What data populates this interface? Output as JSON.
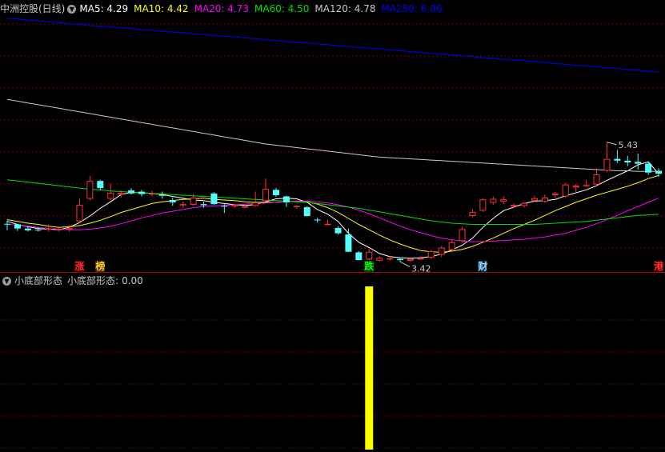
{
  "main_header": {
    "title": "中洲控股(日线)",
    "ma_items": [
      {
        "label": "MA5:",
        "value": "4.29",
        "color": "#ffffff"
      },
      {
        "label": "MA10:",
        "value": "4.42",
        "color": "#ffff00"
      },
      {
        "label": "MA20:",
        "value": "4.73",
        "color": "#ff00ff"
      },
      {
        "label": "MA60:",
        "value": "4.50",
        "color": "#00e000"
      },
      {
        "label": "MA120:",
        "value": "4.78",
        "color": "#c8c8c8"
      },
      {
        "label": "MA250:",
        "value": "6.06",
        "color": "#0000ff"
      }
    ]
  },
  "sub_header": {
    "title": "小底部形态",
    "indicator_label": "小底部形态:",
    "indicator_value": "0.00"
  },
  "event_tags": [
    {
      "text": "涨",
      "color": "#ff3030",
      "bg": "#3a0000",
      "index": 7
    },
    {
      "text": "榜",
      "color": "#ffcc33",
      "bg": "#3a2a00",
      "index": 9
    },
    {
      "text": "跌",
      "color": "#00ff00",
      "bg": "#003a00",
      "index": 35
    },
    {
      "text": "财",
      "color": "#9fd7ff",
      "bg": "#002a4a",
      "index": 46
    },
    {
      "text": "港",
      "color": "#ff3030",
      "bg": "#3a0000",
      "index": 63
    }
  ],
  "price_annotations": {
    "high_label": "5.43",
    "low_label": "3.42"
  },
  "colors": {
    "up": "#ff3232",
    "down": "#54ffff",
    "grid": "#800000",
    "signal": "#ffff00"
  },
  "chart_data": {
    "type": "candlestick",
    "y_axis": "price",
    "ohlc": [
      [
        4.06,
        4.12,
        3.95,
        4.05
      ],
      [
        4.05,
        4.06,
        3.94,
        3.98
      ],
      [
        3.98,
        4.02,
        3.93,
        3.95
      ],
      [
        3.96,
        4.0,
        3.93,
        3.95
      ],
      [
        3.97,
        4.05,
        3.93,
        3.98
      ],
      [
        3.97,
        3.99,
        3.93,
        3.97
      ],
      [
        3.96,
        4.04,
        3.93,
        3.99
      ],
      [
        4.1,
        4.48,
        4.08,
        4.38
      ],
      [
        4.48,
        4.86,
        4.45,
        4.78
      ],
      [
        4.78,
        4.8,
        4.62,
        4.66
      ],
      [
        4.48,
        4.74,
        4.45,
        4.58
      ],
      [
        4.55,
        4.62,
        4.5,
        4.58
      ],
      [
        4.62,
        4.66,
        4.55,
        4.57
      ],
      [
        4.6,
        4.63,
        4.52,
        4.56
      ],
      [
        4.55,
        4.62,
        4.52,
        4.57
      ],
      [
        4.55,
        4.6,
        4.48,
        4.53
      ],
      [
        4.46,
        4.5,
        4.36,
        4.42
      ],
      [
        4.38,
        4.43,
        4.33,
        4.39
      ],
      [
        4.38,
        4.56,
        4.36,
        4.5
      ],
      [
        4.39,
        4.43,
        4.33,
        4.37
      ],
      [
        4.57,
        4.59,
        4.38,
        4.39
      ],
      [
        4.36,
        4.39,
        4.24,
        4.35
      ],
      [
        4.35,
        4.37,
        4.33,
        4.38
      ],
      [
        4.33,
        4.38,
        4.32,
        4.36
      ],
      [
        4.36,
        4.6,
        4.35,
        4.42
      ],
      [
        4.45,
        4.82,
        4.43,
        4.65
      ],
      [
        4.63,
        4.66,
        4.51,
        4.54
      ],
      [
        4.52,
        4.53,
        4.34,
        4.42
      ],
      [
        4.34,
        4.37,
        4.31,
        4.36
      ],
      [
        4.34,
        4.35,
        4.18,
        4.19
      ],
      [
        4.13,
        4.16,
        4.08,
        4.12
      ],
      [
        4.05,
        4.13,
        4.04,
        4.06
      ],
      [
        3.99,
        4.02,
        3.88,
        3.9
      ],
      [
        3.88,
        3.98,
        3.76,
        3.59
      ],
      [
        3.58,
        3.6,
        3.58,
        3.45
      ],
      [
        3.46,
        3.64,
        3.45,
        3.59
      ],
      [
        3.44,
        3.51,
        3.43,
        3.49
      ],
      [
        3.48,
        3.51,
        3.44,
        3.48
      ],
      [
        3.47,
        3.48,
        3.42,
        3.45
      ],
      [
        3.44,
        3.47,
        3.42,
        3.47
      ],
      [
        3.47,
        3.52,
        3.46,
        3.48
      ],
      [
        3.49,
        3.62,
        3.47,
        3.6
      ],
      [
        3.54,
        3.69,
        3.5,
        3.66
      ],
      [
        3.62,
        3.8,
        3.6,
        3.75
      ],
      [
        3.77,
        4.01,
        3.75,
        3.97
      ],
      [
        4.19,
        4.3,
        4.17,
        4.26
      ],
      [
        4.28,
        4.49,
        4.26,
        4.47
      ],
      [
        4.41,
        4.52,
        4.38,
        4.48
      ],
      [
        4.43,
        4.52,
        4.39,
        4.47
      ],
      [
        4.35,
        4.4,
        4.33,
        4.38
      ],
      [
        4.36,
        4.42,
        4.33,
        4.41
      ],
      [
        4.45,
        4.53,
        4.43,
        4.49
      ],
      [
        4.43,
        4.55,
        4.41,
        4.5
      ],
      [
        4.54,
        4.6,
        4.5,
        4.57
      ],
      [
        4.52,
        4.75,
        4.5,
        4.72
      ],
      [
        4.67,
        4.73,
        4.58,
        4.7
      ],
      [
        4.7,
        4.8,
        4.68,
        4.71
      ],
      [
        4.72,
        5.0,
        4.7,
        4.89
      ],
      [
        4.95,
        5.43,
        4.93,
        5.15
      ],
      [
        5.15,
        5.3,
        5.08,
        5.12
      ],
      [
        5.12,
        5.2,
        5.03,
        5.09
      ],
      [
        5.1,
        5.24,
        4.97,
        5.07
      ],
      [
        5.07,
        5.09,
        4.88,
        4.92
      ],
      [
        4.95,
        4.99,
        4.85,
        4.9
      ]
    ],
    "ma_lines": [
      {
        "name": "MA5",
        "color": "#ffffff",
        "values": [
          4.1,
          4.05,
          4.01,
          3.98,
          3.97,
          3.96,
          4.0,
          4.08,
          4.19,
          4.32,
          4.43,
          4.55,
          4.59,
          4.58,
          4.57,
          4.55,
          4.52,
          4.49,
          4.46,
          4.45,
          4.42,
          4.4,
          4.38,
          4.37,
          4.38,
          4.43,
          4.48,
          4.49,
          4.48,
          4.42,
          4.3,
          4.22,
          4.1,
          3.9,
          3.75,
          3.66,
          3.56,
          3.51,
          3.49,
          3.48,
          3.49,
          3.51,
          3.55,
          3.62,
          3.7,
          3.82,
          4.0,
          4.15,
          4.28,
          4.34,
          4.4,
          4.44,
          4.45,
          4.47,
          4.53,
          4.58,
          4.63,
          4.7,
          4.79,
          4.87,
          4.95,
          5.05,
          5.1,
          4.9
        ]
      },
      {
        "name": "MA10",
        "color": "#ffff00",
        "values": [
          4.13,
          4.1,
          4.07,
          4.05,
          4.02,
          4.0,
          4.01,
          4.03,
          4.07,
          4.12,
          4.18,
          4.25,
          4.3,
          4.35,
          4.4,
          4.43,
          4.45,
          4.47,
          4.48,
          4.49,
          4.47,
          4.46,
          4.45,
          4.43,
          4.42,
          4.42,
          4.42,
          4.43,
          4.44,
          4.43,
          4.39,
          4.33,
          4.25,
          4.15,
          4.05,
          3.96,
          3.87,
          3.79,
          3.72,
          3.66,
          3.61,
          3.59,
          3.58,
          3.6,
          3.63,
          3.68,
          3.75,
          3.82,
          3.9,
          3.98,
          4.05,
          4.12,
          4.2,
          4.28,
          4.35,
          4.42,
          4.48,
          4.54,
          4.59,
          4.64,
          4.69,
          4.75,
          4.82,
          4.87
        ]
      },
      {
        "name": "MA20",
        "color": "#ff00ff",
        "values": [
          4.05,
          4.04,
          4.02,
          4.0,
          3.98,
          3.97,
          3.96,
          3.96,
          3.97,
          3.99,
          4.02,
          4.06,
          4.11,
          4.16,
          4.2,
          4.24,
          4.27,
          4.3,
          4.33,
          4.35,
          4.36,
          4.37,
          4.38,
          4.39,
          4.4,
          4.41,
          4.42,
          4.43,
          4.44,
          4.44,
          4.43,
          4.41,
          4.38,
          4.34,
          4.29,
          4.23,
          4.16,
          4.09,
          4.02,
          3.96,
          3.91,
          3.86,
          3.82,
          3.79,
          3.77,
          3.76,
          3.76,
          3.77,
          3.78,
          3.79,
          3.8,
          3.82,
          3.84,
          3.87,
          3.9,
          3.95,
          4.0,
          4.06,
          4.13,
          4.2,
          4.28,
          4.35,
          4.42,
          4.49
        ]
      },
      {
        "name": "MA60",
        "color": "#00e000",
        "values": [
          4.8,
          4.78,
          4.76,
          4.74,
          4.72,
          4.7,
          4.68,
          4.66,
          4.64,
          4.63,
          4.61,
          4.6,
          4.59,
          4.58,
          4.57,
          4.56,
          4.55,
          4.54,
          4.53,
          4.52,
          4.51,
          4.5,
          4.49,
          4.48,
          4.47,
          4.46,
          4.45,
          4.44,
          4.43,
          4.42,
          4.4,
          4.38,
          4.36,
          4.34,
          4.32,
          4.29,
          4.26,
          4.23,
          4.2,
          4.17,
          4.14,
          4.11,
          4.09,
          4.07,
          4.06,
          4.05,
          4.05,
          4.05,
          4.05,
          4.05,
          4.05,
          4.05,
          4.06,
          4.07,
          4.08,
          4.09,
          4.1,
          4.12,
          4.14,
          4.16,
          4.18,
          4.2,
          4.21,
          4.22
        ]
      },
      {
        "name": "MA120",
        "color": "#c8c8c8",
        "values": [
          6.15,
          6.12,
          6.09,
          6.06,
          6.03,
          6.0,
          5.97,
          5.94,
          5.91,
          5.88,
          5.85,
          5.82,
          5.79,
          5.76,
          5.73,
          5.7,
          5.67,
          5.64,
          5.61,
          5.58,
          5.55,
          5.52,
          5.49,
          5.46,
          5.43,
          5.4,
          5.38,
          5.36,
          5.34,
          5.32,
          5.3,
          5.28,
          5.26,
          5.24,
          5.22,
          5.2,
          5.18,
          5.17,
          5.16,
          5.15,
          5.14,
          5.13,
          5.12,
          5.11,
          5.1,
          5.09,
          5.08,
          5.07,
          5.06,
          5.05,
          5.04,
          5.03,
          5.02,
          5.01,
          5.0,
          4.99,
          4.98,
          4.97,
          4.96,
          4.95,
          4.95,
          4.94,
          4.94,
          4.94
        ]
      },
      {
        "name": "MA250",
        "color": "#0000ff",
        "values": [
          7.51,
          7.5,
          7.48,
          7.47,
          7.45,
          7.44,
          7.42,
          7.41,
          7.39,
          7.38,
          7.37,
          7.35,
          7.34,
          7.32,
          7.31,
          7.29,
          7.28,
          7.27,
          7.25,
          7.24,
          7.22,
          7.21,
          7.2,
          7.18,
          7.17,
          7.15,
          7.14,
          7.12,
          7.11,
          7.1,
          7.08,
          7.07,
          7.05,
          7.04,
          7.02,
          7.01,
          7.0,
          6.98,
          6.97,
          6.95,
          6.94,
          6.92,
          6.91,
          6.9,
          6.88,
          6.87,
          6.85,
          6.84,
          6.82,
          6.81,
          6.8,
          6.78,
          6.77,
          6.75,
          6.74,
          6.72,
          6.71,
          6.7,
          6.68,
          6.67,
          6.65,
          6.64,
          6.62,
          6.61
        ]
      }
    ],
    "y_range": [
      3.25,
      7.55
    ],
    "sub_indicator": {
      "name": "小底部形态",
      "values": [
        0,
        0,
        0,
        0,
        0,
        0,
        0,
        0,
        0,
        0,
        0,
        0,
        0,
        0,
        0,
        0,
        0,
        0,
        0,
        0,
        0,
        0,
        0,
        0,
        0,
        0,
        0,
        0,
        0,
        0,
        0,
        0,
        0,
        0,
        0,
        1,
        0,
        0,
        0,
        0,
        0,
        0,
        0,
        0,
        0,
        0,
        0,
        0,
        0,
        0,
        0,
        0,
        0,
        0,
        0,
        0,
        0,
        0,
        0,
        0,
        0,
        0,
        0,
        0
      ],
      "y_range": [
        0,
        1
      ]
    }
  }
}
